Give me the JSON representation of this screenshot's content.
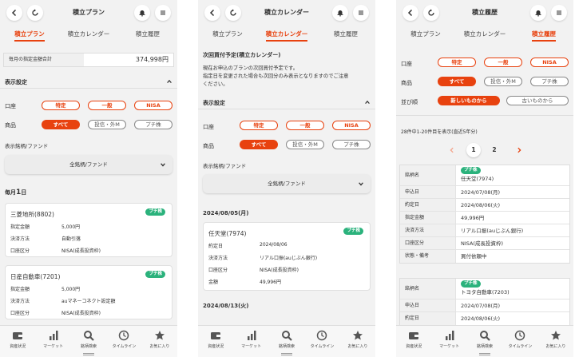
{
  "tabs": [
    "積立プラン",
    "積立カレンダー",
    "積立履歴"
  ],
  "nav": [
    "資産状況",
    "マーケット",
    "銘柄検索",
    "タイムライン",
    "お気に入り"
  ],
  "panel1": {
    "title": "積立プラン",
    "monthly_label": "毎月の指定金額合計",
    "monthly_value": "374,998円",
    "display_settings": "表示設定",
    "account_label": "口座",
    "accounts": [
      "特定",
      "一般",
      "NISA"
    ],
    "product_label": "商品",
    "products": [
      "すべて",
      "投信・外M",
      "プチ株"
    ],
    "fund_label": "表示銘柄/ファンド",
    "fund_select": "全銘柄/ファンド",
    "date_head_prefix": "毎月",
    "date_head_day": "1",
    "date_head_suffix": "日",
    "cards": [
      {
        "name": "三菱地所(8802)",
        "badge": "プチ株",
        "rows": [
          [
            "指定金額",
            "5,000円"
          ],
          [
            "決済方法",
            "自動引落"
          ],
          [
            "口座区分",
            "NISA(成長投資枠)"
          ]
        ]
      },
      {
        "name": "日産自動車(7201)",
        "badge": "プチ株",
        "rows": [
          [
            "指定金額",
            "5,000円"
          ],
          [
            "決済方法",
            "auマネーコネクト設定額"
          ],
          [
            "口座区分",
            "NISA(成長投資枠)"
          ]
        ]
      }
    ]
  },
  "panel2": {
    "title": "積立カレンダー",
    "next_head": "次回買付予定(積立カレンダー)",
    "next_text1": "現在お申込のプランの次回買付予定です。",
    "next_text2": "指定日を変更された場合も次回分のみ表示となりますのでご注意",
    "next_text3": "ください。",
    "display_settings": "表示設定",
    "account_label": "口座",
    "accounts": [
      "特定",
      "一般",
      "NISA"
    ],
    "product_label": "商品",
    "products": [
      "すべて",
      "投信・外M",
      "プチ株"
    ],
    "fund_label": "表示銘柄/ファンド",
    "fund_select": "全銘柄/ファンド",
    "date1": "2024/08/05(月)",
    "card": {
      "name": "任天堂(7974)",
      "badge": "プチ株",
      "rows": [
        [
          "約定日",
          "2024/08/06"
        ],
        [
          "決済方法",
          "リアル口振(auじぶん銀行)"
        ],
        [
          "口座区分",
          "NISA(成長投資枠)"
        ],
        [
          "金額",
          "49,996円"
        ]
      ]
    },
    "date2": "2024/08/13(火)"
  },
  "panel3": {
    "title": "積立履歴",
    "account_label": "口座",
    "accounts": [
      "特定",
      "一般",
      "NISA"
    ],
    "product_label": "商品",
    "products": [
      "すべて",
      "投信・外M",
      "プチ株"
    ],
    "sort_label": "並び順",
    "sorts": [
      "新しいものから",
      "古いものから"
    ],
    "count_text": "28件中1-20件目を表示(直近5年分)",
    "pages": [
      "1",
      "2"
    ],
    "table1": {
      "badge": "プチ株",
      "rows": [
        [
          "銘柄名",
          "任天堂(7974)"
        ],
        [
          "申込日",
          "2024/07/08(月)"
        ],
        [
          "約定日",
          "2024/08/06(火)"
        ],
        [
          "指定金額",
          "49,996円"
        ],
        [
          "決済方法",
          "リアル口振(auじぶん銀行)"
        ],
        [
          "口座区分",
          "NISA(成長投資枠)"
        ],
        [
          "状態・備考",
          "買付依頼中"
        ]
      ]
    },
    "table2": {
      "badge": "プチ株",
      "rows": [
        [
          "銘柄名",
          "トヨタ自動車(7203)"
        ],
        [
          "申込日",
          "2024/07/08(月)"
        ],
        [
          "約定日",
          "2024/08/06(火)"
        ]
      ]
    }
  },
  "colors": {
    "accent": "#e8420f",
    "badge": "#2bb27c"
  }
}
